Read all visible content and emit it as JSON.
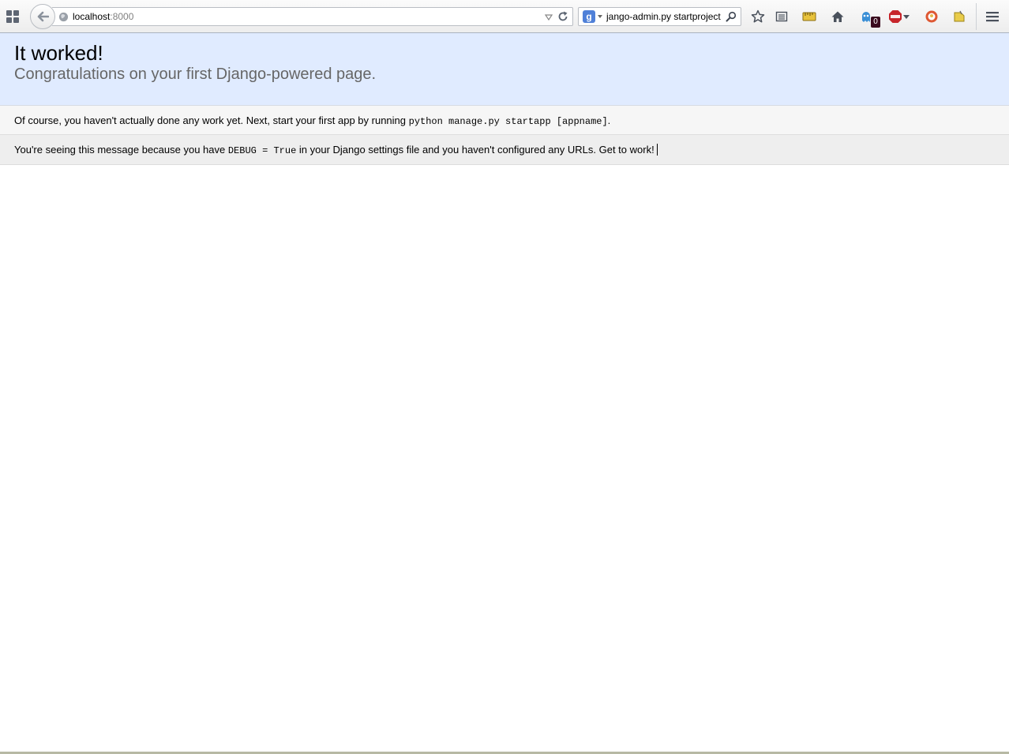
{
  "browser": {
    "url_host": "localhost",
    "url_port": ":8000",
    "search_text": "jango-admin.py startproject",
    "search_engine_letter": "g",
    "addon_badge_count": "0"
  },
  "page": {
    "title": "It worked!",
    "subtitle": "Congratulations on your first Django-powered page.",
    "instructions": {
      "text_before": "Of course, you haven't actually done any work yet. Next, start your first app by running ",
      "code": "python manage.py startapp [appname]",
      "text_after": "."
    },
    "explanation": {
      "text_before": "You're seeing this message because you have ",
      "code": "DEBUG = True",
      "text_after": " in your Django settings file and you haven't configured any URLs. Get to work!"
    }
  },
  "colors": {
    "summary_bg": "#e0ebff",
    "instructions_bg": "#f6f6f6",
    "explanation_bg": "#eeeeee",
    "subtitle": "#666666"
  }
}
